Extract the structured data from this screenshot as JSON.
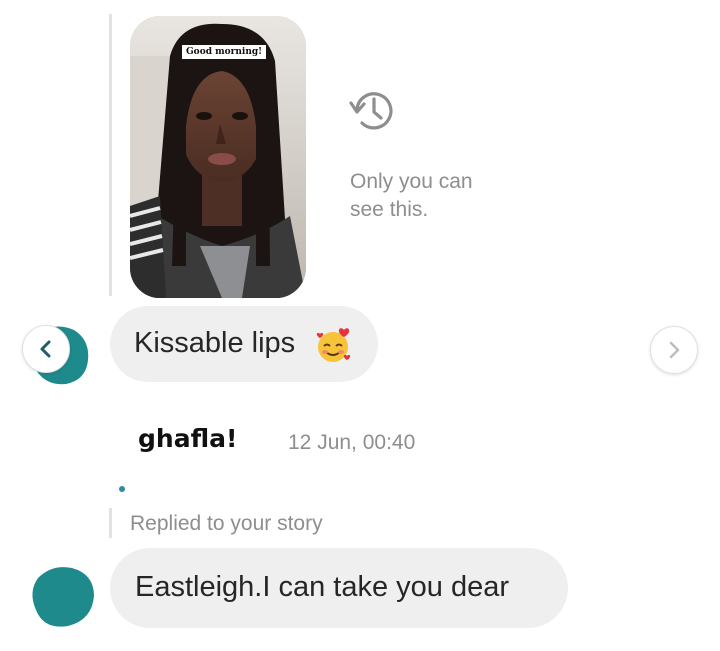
{
  "story": {
    "sticker_text": "Good morning!",
    "history_icon": "history-icon",
    "note": "Only you can see this."
  },
  "messages": [
    {
      "text": "Kissable lips",
      "emoji": "smiling-face-with-hearts-icon"
    },
    {
      "text": "Eastleigh.I can take you dear"
    }
  ],
  "watermark": "ghafla!",
  "timestamp": "12 Jun, 00:40",
  "reply_label": "Replied to your story",
  "nav": {
    "prev_icon": "chevron-left-icon",
    "next_icon": "chevron-right-icon"
  },
  "colors": {
    "bubble": "#efefef",
    "avatar_teal": "#1f8a8c",
    "muted_text": "#8e8e8e",
    "accent_dot": "#2d8ca0"
  }
}
